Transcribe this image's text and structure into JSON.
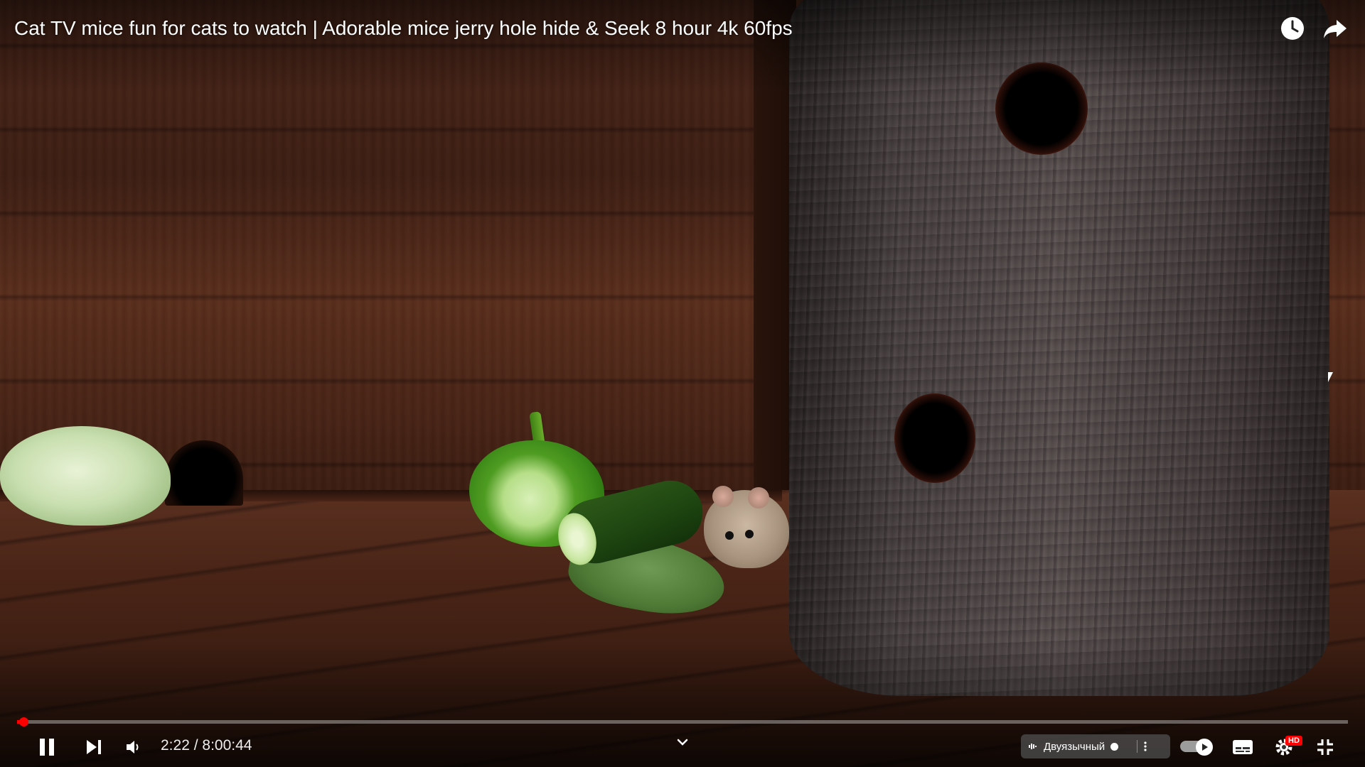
{
  "video": {
    "title": "Cat TV mice fun for cats to watch | Adorable mice jerry hole hide & Seek 8 hour 4k 60fps",
    "current_time": "2:22",
    "separator": " / ",
    "duration": "8:00:44",
    "progress_fraction": 0.0049,
    "progress_color": "#ff0000"
  },
  "top_bar": {
    "icons": [
      "watch-later-icon",
      "share-icon"
    ]
  },
  "controls": {
    "play_state": "playing",
    "left_icons": [
      "pause-icon",
      "next-icon",
      "volume-icon"
    ],
    "audio_track_label": "Двуязычный",
    "right_icons": [
      "autoplay-toggle",
      "subtitles-icon",
      "settings-icon",
      "fullscreen-exit-icon"
    ],
    "quality_badge": "HD",
    "autoplay_on": true
  }
}
